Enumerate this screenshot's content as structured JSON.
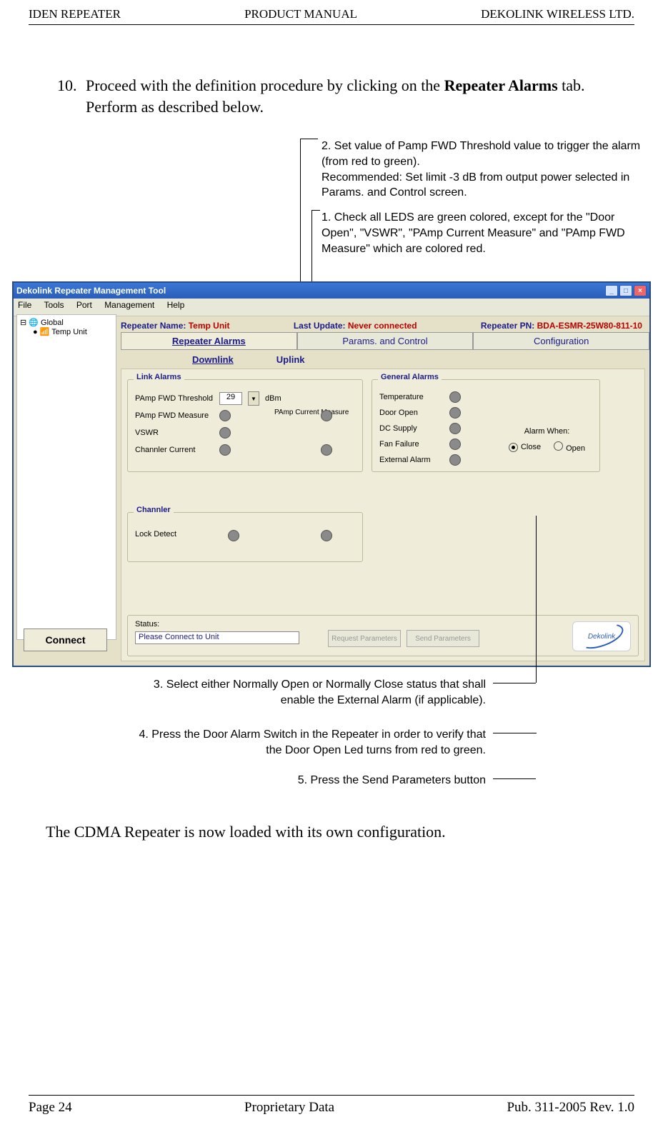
{
  "header": {
    "left": "IDEN REPEATER",
    "center": "PRODUCT MANUAL",
    "right": "DEKOLINK WIRELESS LTD."
  },
  "footer": {
    "left": "Page 24",
    "center": "Proprietary Data",
    "right": "Pub. 311-2005 Rev. 1.0"
  },
  "step": {
    "num": "10.",
    "pre": " Proceed with the definition procedure by clicking on the ",
    "bold": "Repeater Alarms",
    "post": " tab.  Perform as described below."
  },
  "callouts": {
    "c2a": "2. Set value of Pamp FWD Threshold value to trigger the alarm (from red to green).",
    "c2b": "Recommended: Set limit -3 dB from output power selected in Params. and Control screen.",
    "c1": "1. Check all LEDS are green colored, except for the \"Door Open\", \"VSWR\", \"PAmp Current Measure\" and \"PAmp FWD Measure\" which are colored red.",
    "c3": "3. Select either Normally Open or Normally Close status that shall enable the External Alarm (if applicable).",
    "c4": "4. Press the Door Alarm Switch in the Repeater in order to verify that the Door Open Led turns from red to green.",
    "c5": "5. Press the Send Parameters button"
  },
  "app": {
    "title": "Dekolink Repeater Management Tool",
    "menu": {
      "file": "File",
      "tools": "Tools",
      "port": "Port",
      "management": "Management",
      "help": "Help"
    },
    "info": {
      "name_lbl": "Repeater Name:",
      "name_val": "Temp Unit",
      "upd_lbl": "Last Update:",
      "upd_val": "Never connected",
      "pn_lbl": "Repeater PN:",
      "pn_val": "BDA-ESMR-25W80-811-10"
    },
    "tabs": {
      "t1": "Repeater Alarms",
      "t2": "Params. and Control",
      "t3": "Configuration"
    },
    "subtabs": {
      "dl": "Downlink",
      "ul": "Uplink"
    },
    "tree": {
      "root": "Global",
      "child": "Temp Unit"
    },
    "connect": "Connect",
    "groups": {
      "link": "Link Alarms",
      "general": "General Alarms",
      "channler": "Channler"
    },
    "link": {
      "pft": "PAmp FWD Threshold",
      "pft_val": "29",
      "pft_unit": "dBm",
      "pfm": "PAmp FWD Measure",
      "vswr": "VSWR",
      "cc": "Channler Current",
      "pcm": "PAmp Current Measure"
    },
    "gen": {
      "temp": "Temperature",
      "door": "Door Open",
      "dc": "DC Supply",
      "fan": "Fan Failure",
      "ext": "External Alarm",
      "aw": "Alarm When:",
      "close": "Close",
      "open": "Open"
    },
    "chan": {
      "lock": "Lock Detect"
    },
    "status": {
      "lbl": "Status:",
      "val": "Please Connect to Unit",
      "req": "Request Parameters",
      "send": "Send  Parameters"
    },
    "logo": "Dekolink"
  },
  "posttext": "The CDMA Repeater is now loaded with its own configuration."
}
